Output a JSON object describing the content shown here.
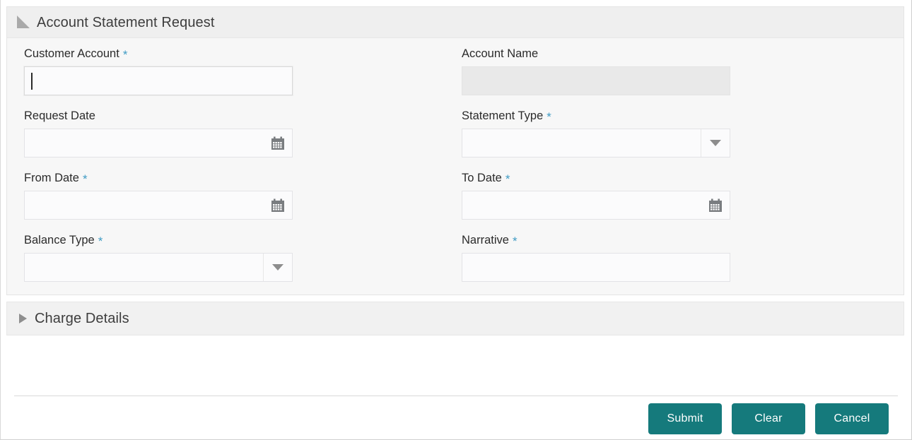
{
  "panels": {
    "main": {
      "title": "Account Statement Request",
      "expanded": true,
      "toggle_icon": "triangle-expanded-icon"
    },
    "charge_details": {
      "title": "Charge Details",
      "expanded": false,
      "toggle_icon": "triangle-collapsed-icon"
    }
  },
  "fields": {
    "customer_account": {
      "label": "Customer Account",
      "required_marker": "*",
      "value": "",
      "placeholder": "",
      "state": "focused",
      "type": "text"
    },
    "account_name": {
      "label": "Account Name",
      "required_marker": "",
      "value": "",
      "placeholder": "",
      "state": "readonly",
      "type": "text"
    },
    "request_date": {
      "label": "Request Date",
      "required_marker": "",
      "value": "",
      "placeholder": "",
      "state": "enabled",
      "type": "date",
      "icon": "calendar-icon"
    },
    "statement_type": {
      "label": "Statement Type",
      "required_marker": "*",
      "value": "",
      "placeholder": "",
      "state": "enabled",
      "type": "select",
      "icon": "chevron-down-icon"
    },
    "from_date": {
      "label": "From Date",
      "required_marker": "*",
      "value": "",
      "placeholder": "",
      "state": "enabled",
      "type": "date",
      "icon": "calendar-icon"
    },
    "to_date": {
      "label": "To Date",
      "required_marker": "*",
      "value": "",
      "placeholder": "",
      "state": "enabled",
      "type": "date",
      "icon": "calendar-icon"
    },
    "balance_type": {
      "label": "Balance Type",
      "required_marker": "*",
      "value": "",
      "placeholder": "",
      "state": "enabled",
      "type": "select",
      "icon": "chevron-down-icon"
    },
    "narrative": {
      "label": "Narrative",
      "required_marker": "*",
      "value": "",
      "placeholder": "",
      "state": "enabled",
      "type": "text"
    }
  },
  "footer": {
    "submit_label": "Submit",
    "clear_label": "Clear",
    "cancel_label": "Cancel"
  },
  "colors": {
    "accent": "#157a7c",
    "required_asterisk": "#3f9bc4",
    "panel_bg": "#f7f7f7",
    "header_bg": "#efefef",
    "readonly_bg": "#e9e9e9"
  }
}
